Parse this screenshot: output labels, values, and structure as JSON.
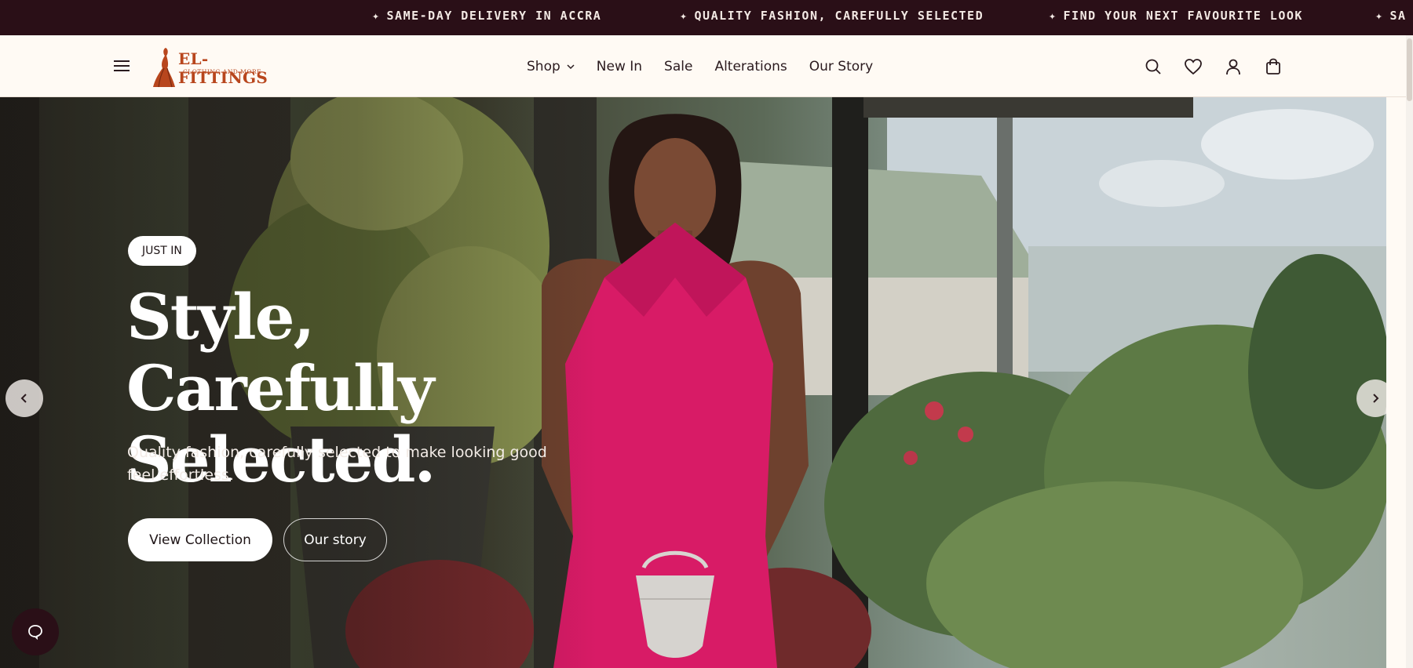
{
  "announcement": {
    "items": [
      "SAME-DAY DELIVERY IN ACCRA",
      "QUALITY FASHION, CAREFULLY SELECTED",
      "FIND YOUR NEXT FAVOURITE LOOK",
      "SA"
    ],
    "star": "✦",
    "background": "#2a0f17"
  },
  "header": {
    "logo": {
      "word": "EL-FITTINGS",
      "sub": "CLOTHING AND MORE",
      "color": "#b8461d"
    },
    "nav": [
      {
        "label": "Shop",
        "has_dropdown": true
      },
      {
        "label": "New In"
      },
      {
        "label": "Sale"
      },
      {
        "label": "Alterations"
      },
      {
        "label": "Our Story"
      }
    ],
    "icons": [
      "search-icon",
      "heart-icon",
      "account-icon",
      "cart-icon"
    ]
  },
  "hero": {
    "badge": "JUST IN",
    "headline_line1": "Style, Carefully",
    "headline_line2": "Selected.",
    "subtext": "Quality fashion, carefully selected to make looking good feel effortless.",
    "primary_cta": "View Collection",
    "secondary_cta": "Our story",
    "dress_color": "#d81b66"
  }
}
